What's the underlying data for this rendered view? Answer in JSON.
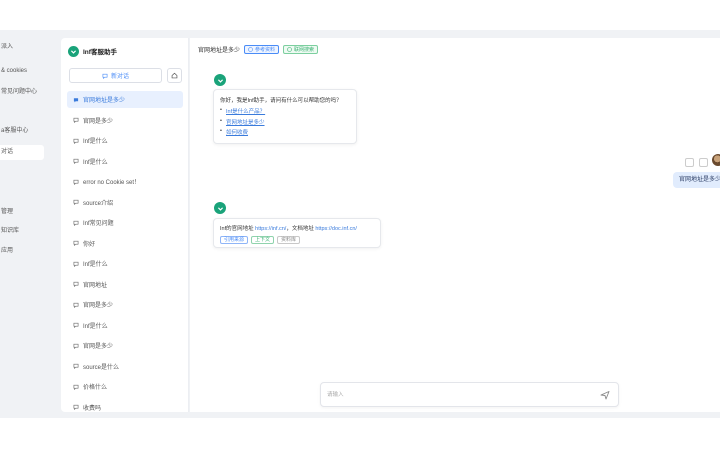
{
  "nav": {
    "items": [
      "派入",
      "& cookies",
      "常见问题中心",
      "a客服中心",
      "对话",
      "管理",
      "知识库",
      "应用"
    ],
    "active_index": 4
  },
  "sidebar": {
    "brand": "Inf客服助手",
    "new_chat_label": "新对话",
    "sessions": [
      "官网地址是多少",
      "官网是多少",
      "Inf是什么",
      "Inf是什么",
      "error no Cookie set！",
      "source介绍",
      "Inf常见问题",
      "你好",
      "Inf是什么",
      "官网地址",
      "官网是多少",
      "Inf是什么",
      "官网是多少",
      "source是什么",
      "价格什么",
      "收费吗"
    ],
    "active_index": 0
  },
  "chat": {
    "title": "官网地址是多少",
    "tag_primary": "参考资料",
    "tag_secondary": "联网搜索",
    "greeting": "你好，我是Inf助手，请问有什么可以帮助您的吗？",
    "suggestions": [
      "Inf是什么产品？",
      "官网地址是多少",
      "如何收费"
    ],
    "user_message": "官网地址是多少",
    "answer_prefix": "Inf的官网地址 ",
    "answer_link1": "https://inf.cn/",
    "answer_mid": "，文档地址 ",
    "answer_link2": "https://doc.inf.cn/",
    "answer_chips": [
      "引用来源",
      "上下文",
      "资料库"
    ],
    "input_placeholder": "请输入"
  },
  "colors": {
    "accent": "#4a8cf7",
    "brand": "#1aa37a",
    "bubble": "#e1ecfd"
  }
}
